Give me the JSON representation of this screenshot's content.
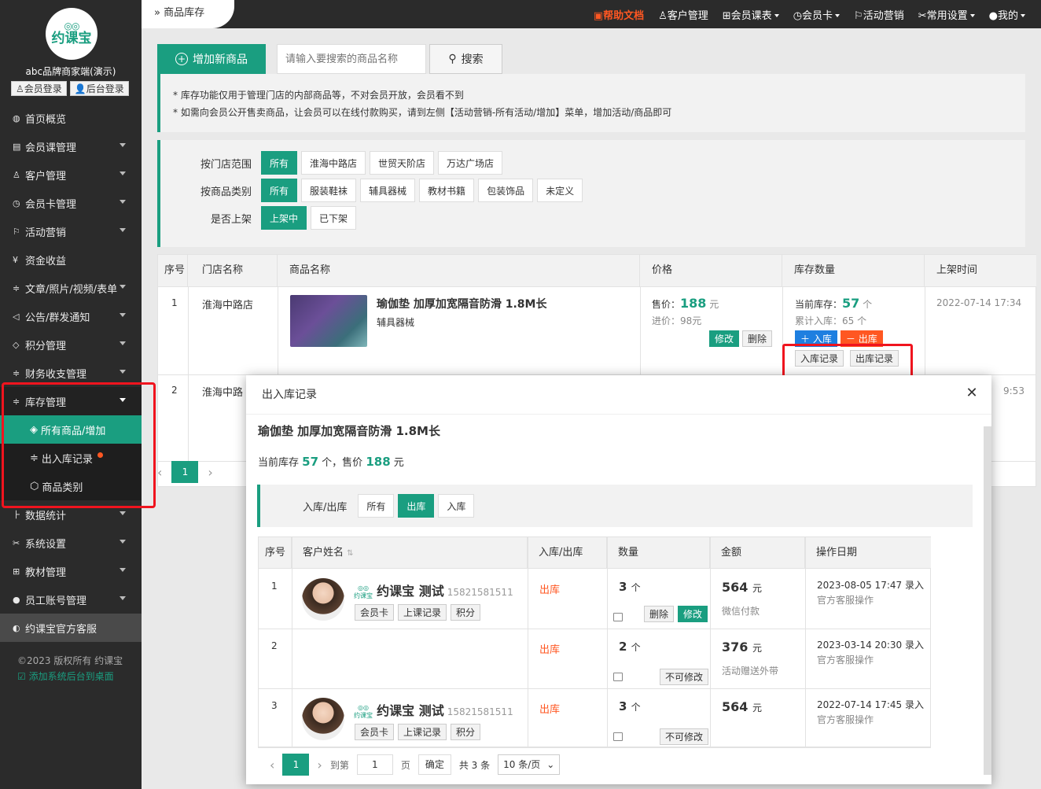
{
  "sidebar": {
    "logo_text": "约课宝",
    "brand": "abc品牌商家端(演示)",
    "member_login": "会员登录",
    "admin_login": "后台登录",
    "items": [
      {
        "label": "首页概览",
        "icon": "globe-icon",
        "arrow": false
      },
      {
        "label": "会员课管理",
        "icon": "doc-icon",
        "arrow": true
      },
      {
        "label": "客户管理",
        "icon": "user-icon",
        "arrow": true
      },
      {
        "label": "会员卡管理",
        "icon": "clock-icon",
        "arrow": true
      },
      {
        "label": "活动营销",
        "icon": "flag-icon",
        "arrow": true
      },
      {
        "label": "资金收益",
        "icon": "yen-icon",
        "arrow": false
      },
      {
        "label": "文章/照片/视频/表单",
        "icon": "sliders-icon",
        "arrow": true
      },
      {
        "label": "公告/群发通知",
        "icon": "speaker-icon",
        "arrow": true
      },
      {
        "label": "积分管理",
        "icon": "diamond-icon",
        "arrow": true
      },
      {
        "label": "财务收支管理",
        "icon": "sliders-icon",
        "arrow": true
      }
    ],
    "inventory": {
      "label": "库存管理",
      "sub": [
        "所有商品/增加",
        "出入库记录",
        "商品类别"
      ]
    },
    "items_after": [
      {
        "label": "数据统计",
        "icon": "chart-icon",
        "arrow": true
      },
      {
        "label": "系统设置",
        "icon": "tools-icon",
        "arrow": true
      },
      {
        "label": "教材管理",
        "icon": "book-icon",
        "arrow": true
      },
      {
        "label": "员工账号管理",
        "icon": "person-icon",
        "arrow": true
      }
    ],
    "service": "约课宝官方客服",
    "copyright": "©2023 版权所有 约课宝",
    "add_desktop": "添加系统后台到桌面"
  },
  "topbar": {
    "breadcrumb": "商品库存",
    "nav": [
      "帮助文档",
      "客户管理",
      "会员课表",
      "会员卡",
      "活动营销",
      "常用设置",
      "我的"
    ]
  },
  "main": {
    "add_button": "增加新商品",
    "search_placeholder": "请输入要搜索的商品名称",
    "search_button": "搜索",
    "notice": [
      "* 库存功能仅用于管理门店的内部商品等，不对会员开放，会员看不到",
      "* 如需向会员公开售卖商品，让会员可以在线付款购买，请到左侧【活动营销-所有活动/增加】菜单，增加活动/商品即可"
    ],
    "filters": {
      "store_label": "按门店范围",
      "stores": [
        "所有",
        "淮海中路店",
        "世贸天阶店",
        "万达广场店"
      ],
      "cat_label": "按商品类别",
      "cats": [
        "所有",
        "服装鞋袜",
        "辅具器械",
        "教材书籍",
        "包装饰品",
        "未定义"
      ],
      "shelf_label": "是否上架",
      "shelf": [
        "上架中",
        "已下架"
      ]
    },
    "table": {
      "headers": [
        "序号",
        "门店名称",
        "商品名称",
        "价格",
        "库存数量",
        "上架时间"
      ],
      "row1": {
        "no": "1",
        "store": "淮海中路店",
        "product": "瑜伽垫 加厚加宽隔音防滑 1.8M长",
        "category": "辅具器械",
        "sale_label": "售价：",
        "sale": "188",
        "yuan": "元",
        "cost": "进价：98元",
        "edit": "修改",
        "delete": "删除",
        "stock_label": "当前库存：",
        "stock": "57",
        "unit": "个",
        "total_in": "累计入库：65 个",
        "in_btn": "入库",
        "out_btn": "出库",
        "in_record": "入库记录",
        "out_record": "出库记录",
        "time": "2022-07-14 17:34"
      },
      "row2": {
        "no": "2",
        "store": "淮海中路",
        "time_tail": "9:53"
      }
    },
    "page": "1"
  },
  "modal": {
    "title": "出入库记录",
    "product": "瑜伽垫 加厚加宽隔音防滑 1.8M长",
    "stock_prefix": "当前库存",
    "stock": "57",
    "stock_mid": "个，售价",
    "price": "188",
    "price_suffix": "元",
    "filter_label": "入库/出库",
    "filter_opts": [
      "所有",
      "出库",
      "入库"
    ],
    "headers": [
      "序号",
      "客户姓名",
      "入库/出库",
      "数量",
      "金额",
      "操作日期"
    ],
    "rows": [
      {
        "no": "1",
        "name": "约课宝 测试",
        "phone": "15821581511",
        "tags": [
          "会员卡",
          "上课记录",
          "积分"
        ],
        "type": "出库",
        "qty": "3",
        "unit": "个",
        "amount": "564",
        "yuan": "元",
        "pay": "微信付款",
        "date": "2023-08-05 17:47 录入",
        "op": "官方客服操作",
        "del": "删除",
        "edit": "修改"
      },
      {
        "no": "2",
        "name": "",
        "phone": "",
        "tags": [],
        "type": "出库",
        "qty": "2",
        "unit": "个",
        "amount": "376",
        "yuan": "元",
        "pay": "活动赠送外带",
        "date": "2023-03-14 20:30 录入",
        "op": "官方客服操作",
        "noedit": "不可修改"
      },
      {
        "no": "3",
        "name": "约课宝 测试",
        "phone": "15821581511",
        "tags": [
          "会员卡",
          "上课记录",
          "积分"
        ],
        "type": "出库",
        "qty": "3",
        "unit": "个",
        "amount": "564",
        "yuan": "元",
        "pay": "",
        "date": "2022-07-14 17:45 录入",
        "op": "官方客服操作",
        "noedit": "不可修改"
      }
    ],
    "pager": {
      "page": "1",
      "goto": "到第",
      "page_input": "1",
      "page_unit": "页",
      "confirm": "确定",
      "total": "共 3 条",
      "size": "10 条/页"
    }
  },
  "colors": {
    "accent": "#1a9e80",
    "out": "#ff5722",
    "highlight": "#f0141e",
    "sidebar": "#2b2b2b"
  }
}
